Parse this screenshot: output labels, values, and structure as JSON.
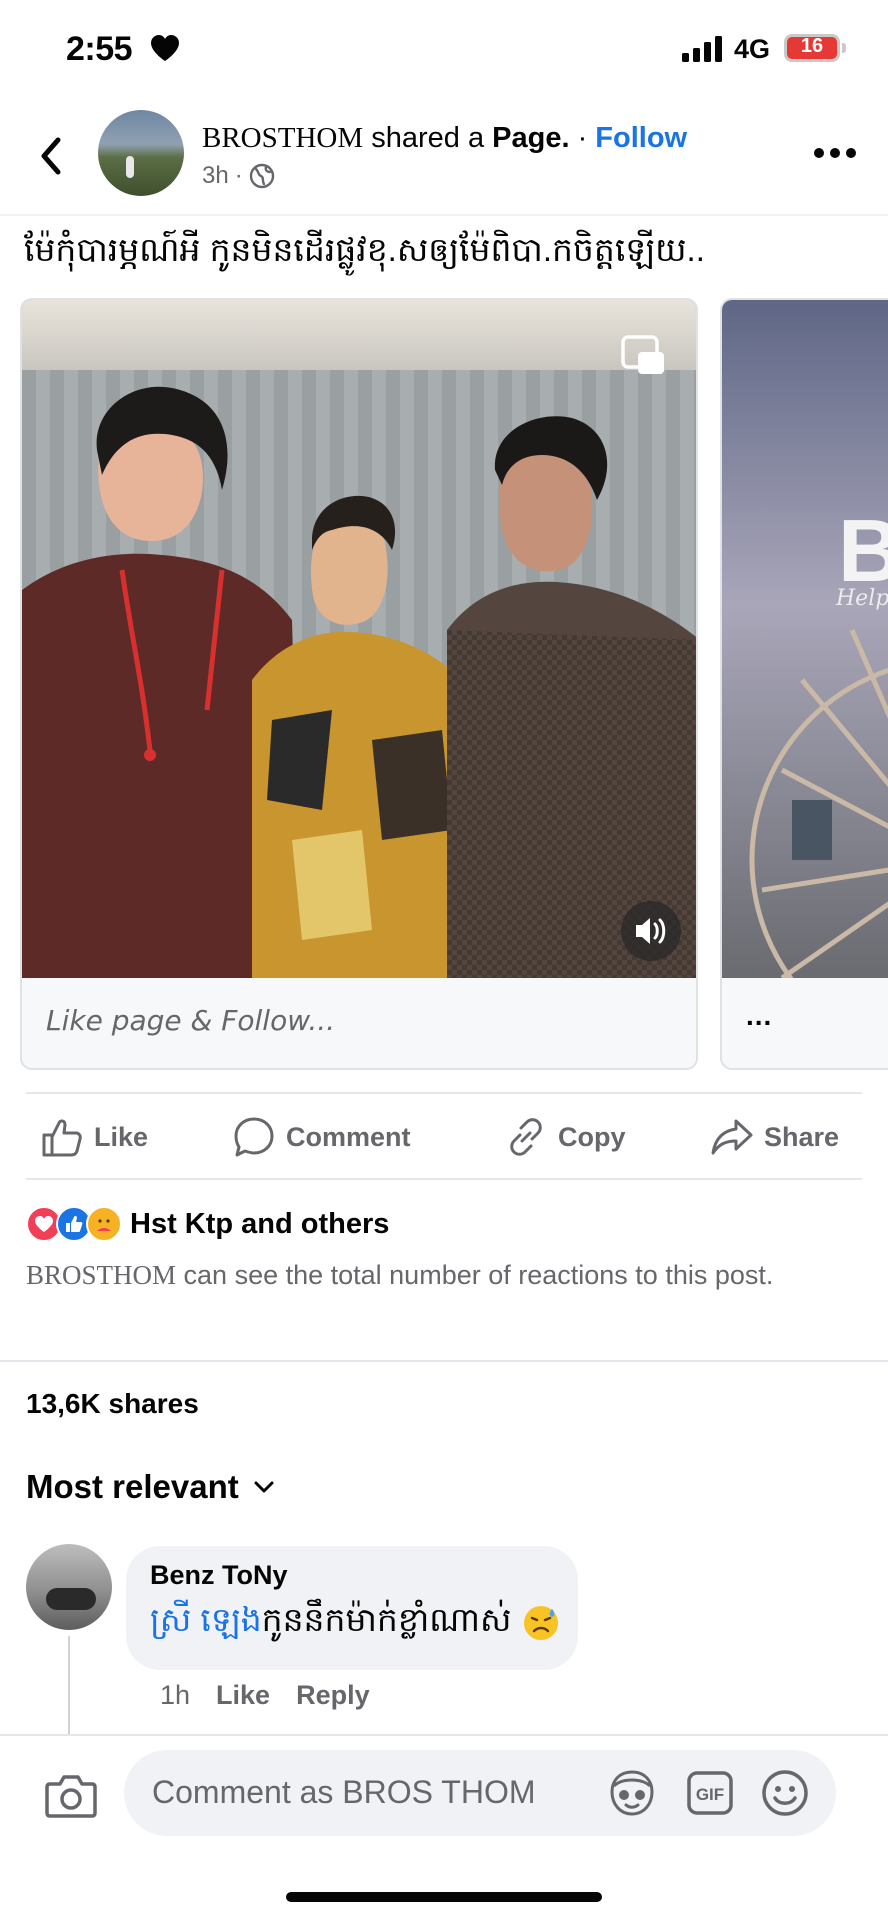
{
  "status_bar": {
    "time": "2:55",
    "network": "4G",
    "battery": "16"
  },
  "header": {
    "page_name": "BROSTHOM",
    "action_text": " shared a ",
    "object": "Page.",
    "separator": " · ",
    "follow_label": "Follow",
    "time_ago": "3h",
    "dot": "·"
  },
  "post": {
    "caption": "ម៉ែកុំបារម្ភណ៍អី កូនមិនដើរផ្លូវខុ.សឲ្យម៉ែពិបា.កចិត្តឡើយ.."
  },
  "carousel": {
    "cards": [
      {
        "caption": "Like page & Follow..."
      },
      {
        "caption": "...",
        "overlay_letter": "B",
        "overlay_sub": "Help L"
      }
    ]
  },
  "actions": {
    "like": "Like",
    "comment": "Comment",
    "copy": "Copy",
    "share": "Share"
  },
  "reactions": {
    "names": "Hst Ktp and others",
    "note_name": "BROSTHOM",
    "note_text": " can see the total number of reactions to this post."
  },
  "shares": "13,6K shares",
  "sort": {
    "label": "Most relevant"
  },
  "comments": [
    {
      "author": "Benz ToNy",
      "mention": "ស្រី ឡេង",
      "text": "កូននឹកម៉ាក់ខ្លាំណាស់",
      "time": "1h",
      "like": "Like",
      "reply": "Reply"
    }
  ],
  "composer": {
    "placeholder": "Comment as BROS THOM"
  },
  "colors": {
    "accent": "#1b74e4",
    "secondary_text": "#65676b",
    "bubble": "#f0f2f5"
  }
}
